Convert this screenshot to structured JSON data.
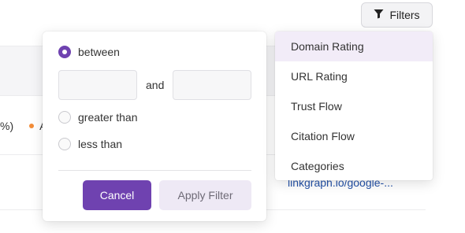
{
  "toolbar": {
    "filters_label": "Filters",
    "filters_icon": "funnel-icon"
  },
  "background": {
    "row_text_left": "%)",
    "row_text_right": "A",
    "link_text": "linkgraph.io/google-..."
  },
  "filter_popover": {
    "options": [
      {
        "label": "between",
        "checked": true
      },
      {
        "label": "greater than",
        "checked": false
      },
      {
        "label": "less than",
        "checked": false
      }
    ],
    "min_value": "",
    "max_value": "",
    "and_label": "and",
    "cancel_label": "Cancel",
    "apply_label": "Apply Filter"
  },
  "filter_menu": {
    "items": [
      {
        "label": "Domain Rating",
        "active": true
      },
      {
        "label": "URL Rating",
        "active": false
      },
      {
        "label": "Trust Flow",
        "active": false
      },
      {
        "label": "Citation Flow",
        "active": false
      },
      {
        "label": "Categories",
        "active": false
      }
    ]
  },
  "colors": {
    "accent": "#6f42b0",
    "accent_light": "#eee9f5",
    "menu_highlight": "#f2ecf8",
    "status_dot": "#f28c38",
    "link": "#2452a8"
  }
}
